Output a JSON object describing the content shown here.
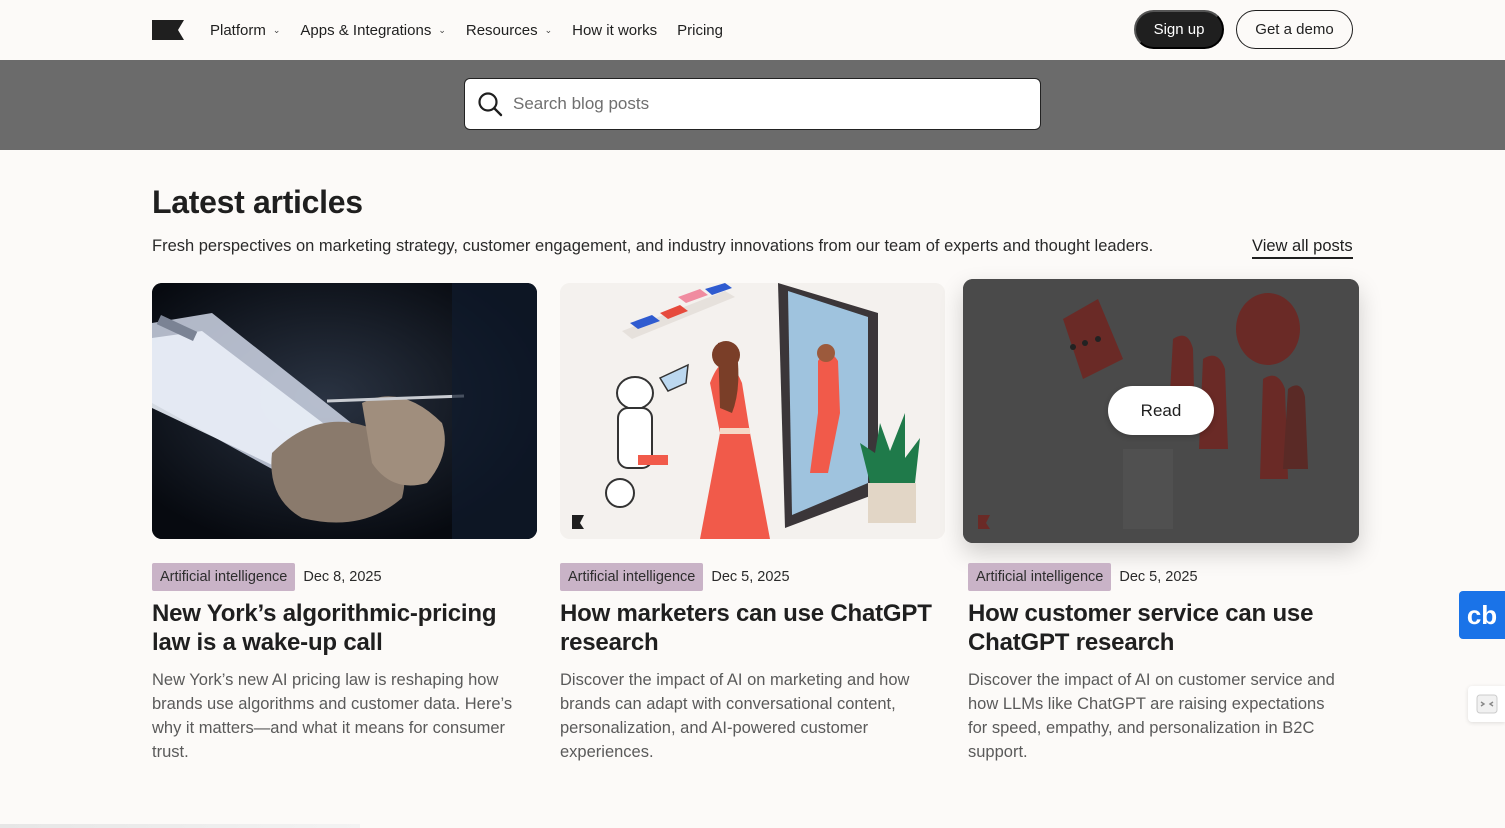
{
  "nav": {
    "items": [
      {
        "label": "Platform",
        "has_dropdown": true
      },
      {
        "label": "Apps & Integrations",
        "has_dropdown": true
      },
      {
        "label": "Resources",
        "has_dropdown": true
      },
      {
        "label": "How it works",
        "has_dropdown": false
      },
      {
        "label": "Pricing",
        "has_dropdown": false
      }
    ],
    "signup_label": "Sign up",
    "demo_label": "Get a demo"
  },
  "search": {
    "placeholder": "Search blog posts",
    "icon": "search-icon"
  },
  "section": {
    "title": "Latest articles",
    "subtitle": "Fresh perspectives on marketing strategy, customer engagement, and industry innovations from our team of experts and thought leaders.",
    "view_all_label": "View all posts"
  },
  "articles": [
    {
      "tag": "Artificial intelligence",
      "date": "Dec 8, 2025",
      "title": "New York’s algorithmic-pricing law is a wake-up call",
      "description": "New York’s new AI pricing law is reshaping how brands use algorithms and customer data. Here’s why it matters—and what it means for consumer trust."
    },
    {
      "tag": "Artificial intelligence",
      "date": "Dec 5, 2025",
      "title": "How marketers can use ChatGPT research",
      "description": "Discover the impact of AI on marketing and how brands can adapt with conversational content, personalization, and AI-powered customer experiences."
    },
    {
      "tag": "Artificial intelligence",
      "date": "Dec 5, 2025",
      "title": "How customer service can use ChatGPT research",
      "description": "Discover the impact of AI on customer service and how LLMs like ChatGPT are raising expectations for speed, empathy, and personalization in B2C support.",
      "hover_label": "Read"
    }
  ],
  "widgets": {
    "cb_label": "cb"
  },
  "colors": {
    "background": "#fcfaf8",
    "dark": "#1f1f1f",
    "search_band": "#6b6b6b",
    "tag_bg": "#c9b3c7",
    "widget_blue": "#1a73e8"
  }
}
